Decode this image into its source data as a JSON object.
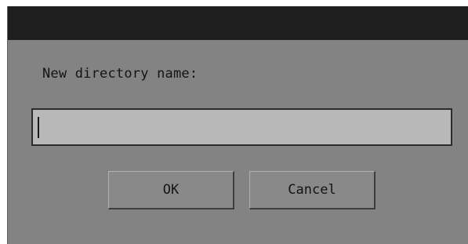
{
  "dialog": {
    "prompt": "New directory name:",
    "input_value": "",
    "ok_label": "OK",
    "cancel_label": "Cancel"
  },
  "colors": {
    "titlebar": "#1e1e1e",
    "dialog_background": "#838383",
    "input_background": "#b8b8b8",
    "text": "#141414"
  }
}
